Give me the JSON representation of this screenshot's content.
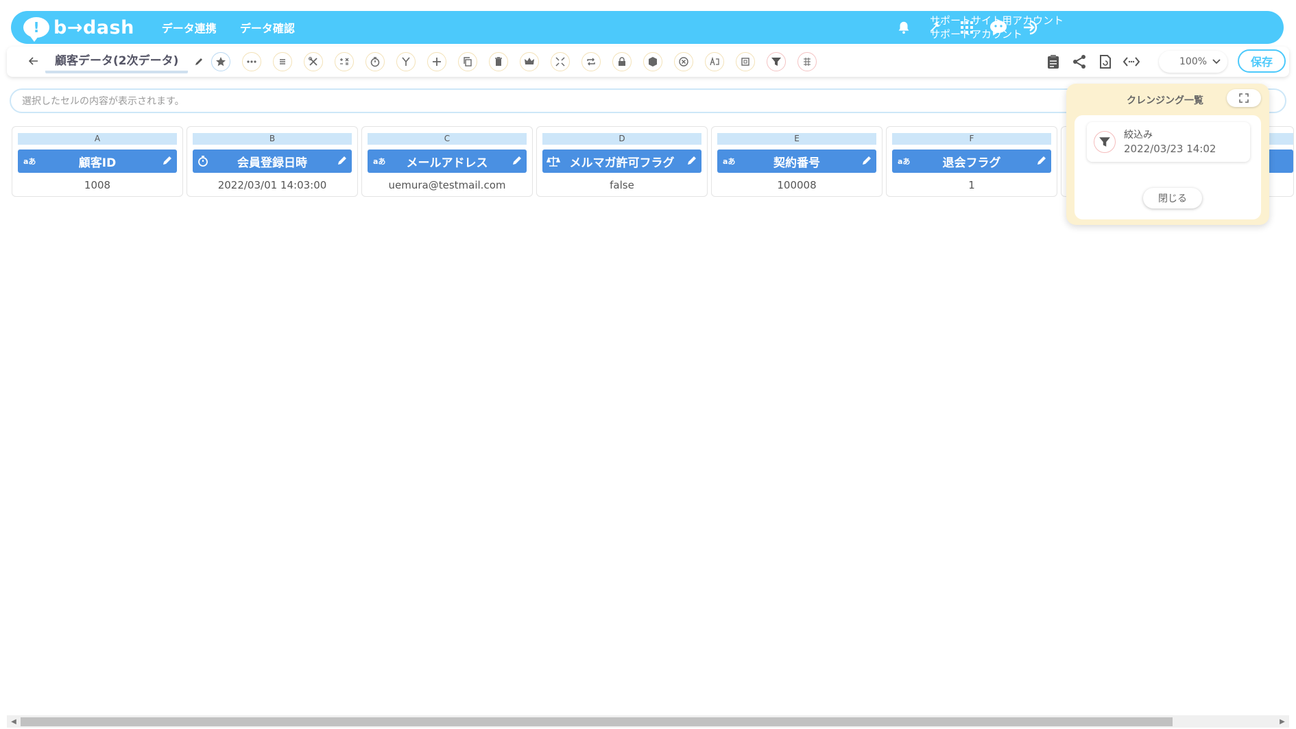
{
  "header": {
    "logo_text": "b→dash",
    "nav": [
      "データ連携",
      "データ確認"
    ],
    "account_line1": "サポートサイト用アカウント",
    "account_line2": "サポートアカウント"
  },
  "toolbar": {
    "title": "顧客データ(2次データ)",
    "zoom": "100%",
    "save_label": "保存"
  },
  "cell_bar": {
    "placeholder": "選択したセルの内容が表示されます。"
  },
  "columns": [
    {
      "letter": "A",
      "name": "顧客ID",
      "type": "text",
      "type_label": "aあ",
      "value": "1008"
    },
    {
      "letter": "B",
      "name": "会員登録日時",
      "type": "datetime",
      "type_label": "",
      "value": "2022/03/01 14:03:00"
    },
    {
      "letter": "C",
      "name": "メールアドレス",
      "type": "text",
      "type_label": "aあ",
      "value": "uemura@testmail.com"
    },
    {
      "letter": "D",
      "name": "メルマガ許可フラグ",
      "type": "boolean",
      "type_label": "",
      "value": "false"
    },
    {
      "letter": "E",
      "name": "契約番号",
      "type": "text",
      "type_label": "aあ",
      "value": "100008"
    },
    {
      "letter": "F",
      "name": "退会フラグ",
      "type": "text",
      "type_label": "aあ",
      "value": "1"
    }
  ],
  "cleansing_panel": {
    "title": "クレンジング一覧",
    "steps": [
      {
        "name": "絞込み",
        "time": "2022/03/23 14:02",
        "icon": "filter-icon"
      }
    ],
    "close_label": "閉じる"
  },
  "colors": {
    "brand": "#4cc9fb",
    "column_header": "#4a90e2",
    "panel_bg": "#fcf1d0"
  }
}
